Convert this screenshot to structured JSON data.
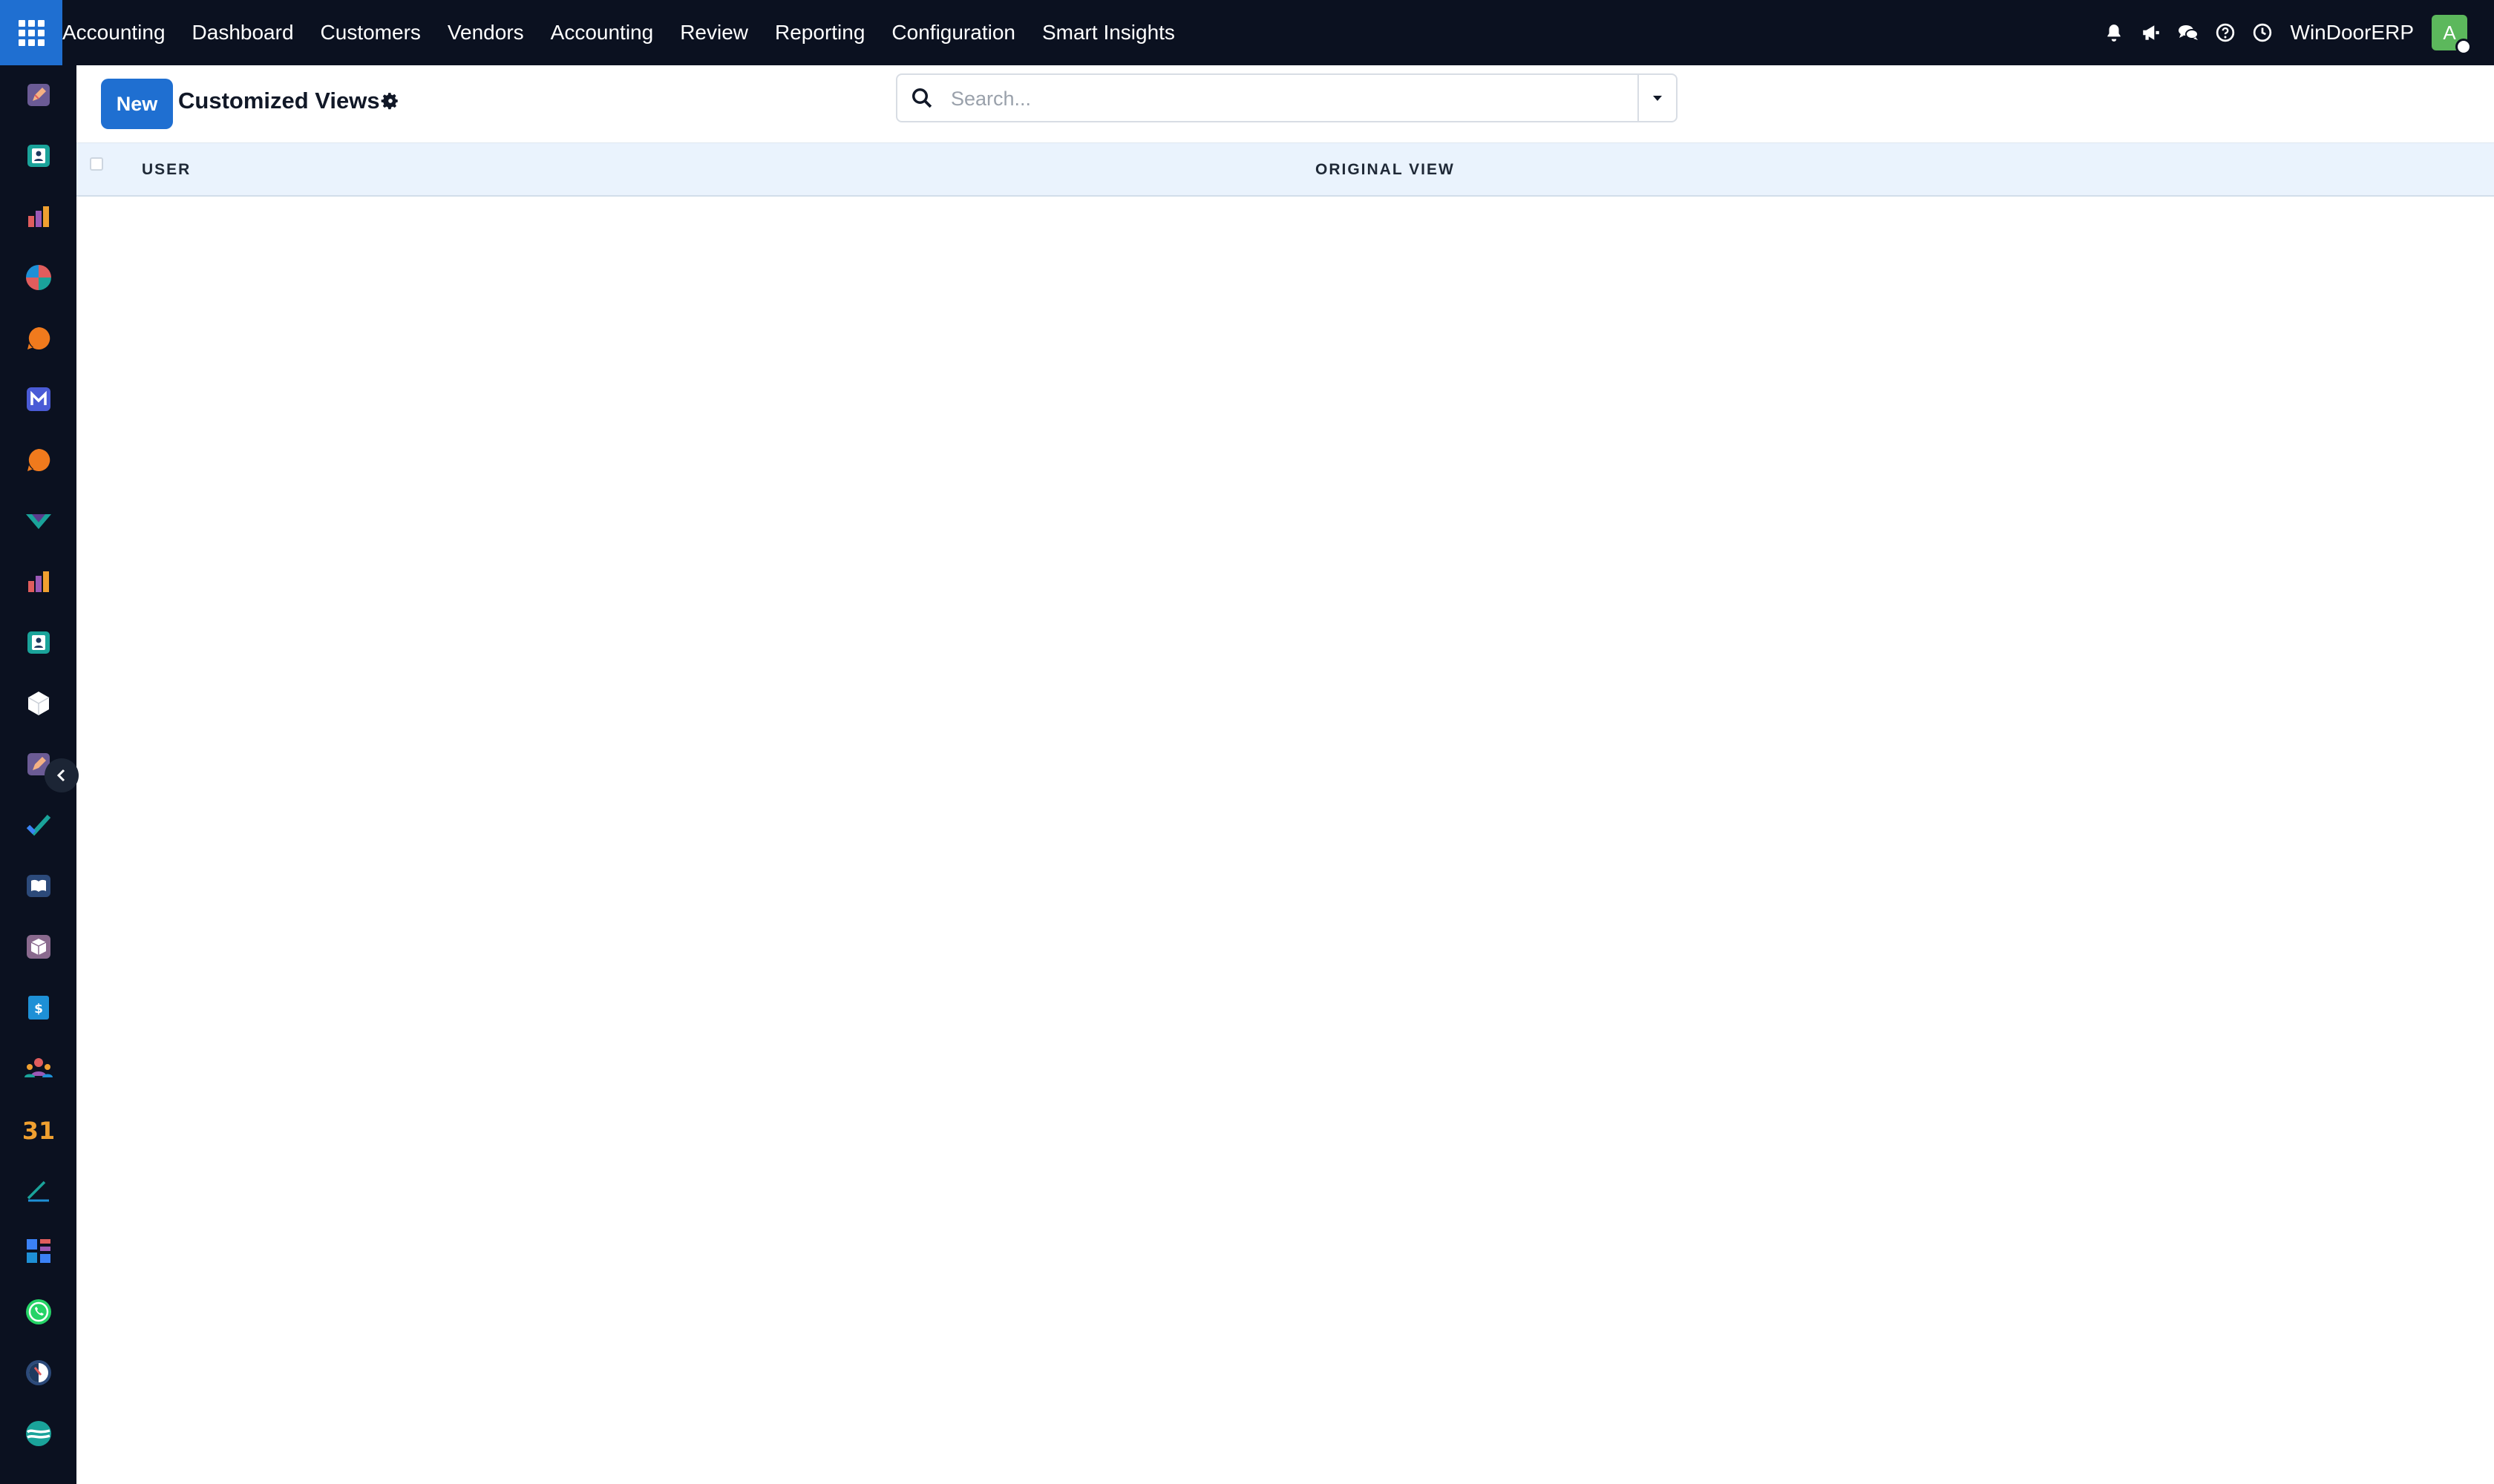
{
  "topbar": {
    "brand": "Accounting",
    "menu": [
      "Dashboard",
      "Customers",
      "Vendors",
      "Accounting",
      "Review",
      "Reporting",
      "Configuration",
      "Smart Insights"
    ],
    "company": "WinDoorERP",
    "avatar_initial": "A",
    "icons": [
      "bell-icon",
      "megaphone-icon",
      "chat-icon",
      "help-icon",
      "clock-icon"
    ]
  },
  "sidebar": {
    "apps": [
      "app-pencil",
      "app-contacts",
      "app-reporting",
      "app-pie",
      "app-discuss",
      "app-mail",
      "app-discuss-2",
      "app-survey",
      "app-reporting-2",
      "app-contacts-2",
      "app-inventory",
      "app-pencil-2",
      "app-todo",
      "app-knowledge",
      "app-product",
      "app-invoicing",
      "app-employees",
      "app-calendar",
      "app-sign",
      "app-dashboards",
      "app-whatsapp",
      "app-moon",
      "app-wave"
    ]
  },
  "control": {
    "new_label": "New",
    "title": "Customized Views",
    "search_placeholder": "Search..."
  },
  "table": {
    "columns": [
      "USER",
      "ORIGINAL VIEW"
    ],
    "rows": []
  },
  "colors": {
    "navbar": "#0b1120",
    "primary": "#1f6fd1",
    "header_row": "#eaf3fd",
    "avatar": "#5cb85c"
  }
}
